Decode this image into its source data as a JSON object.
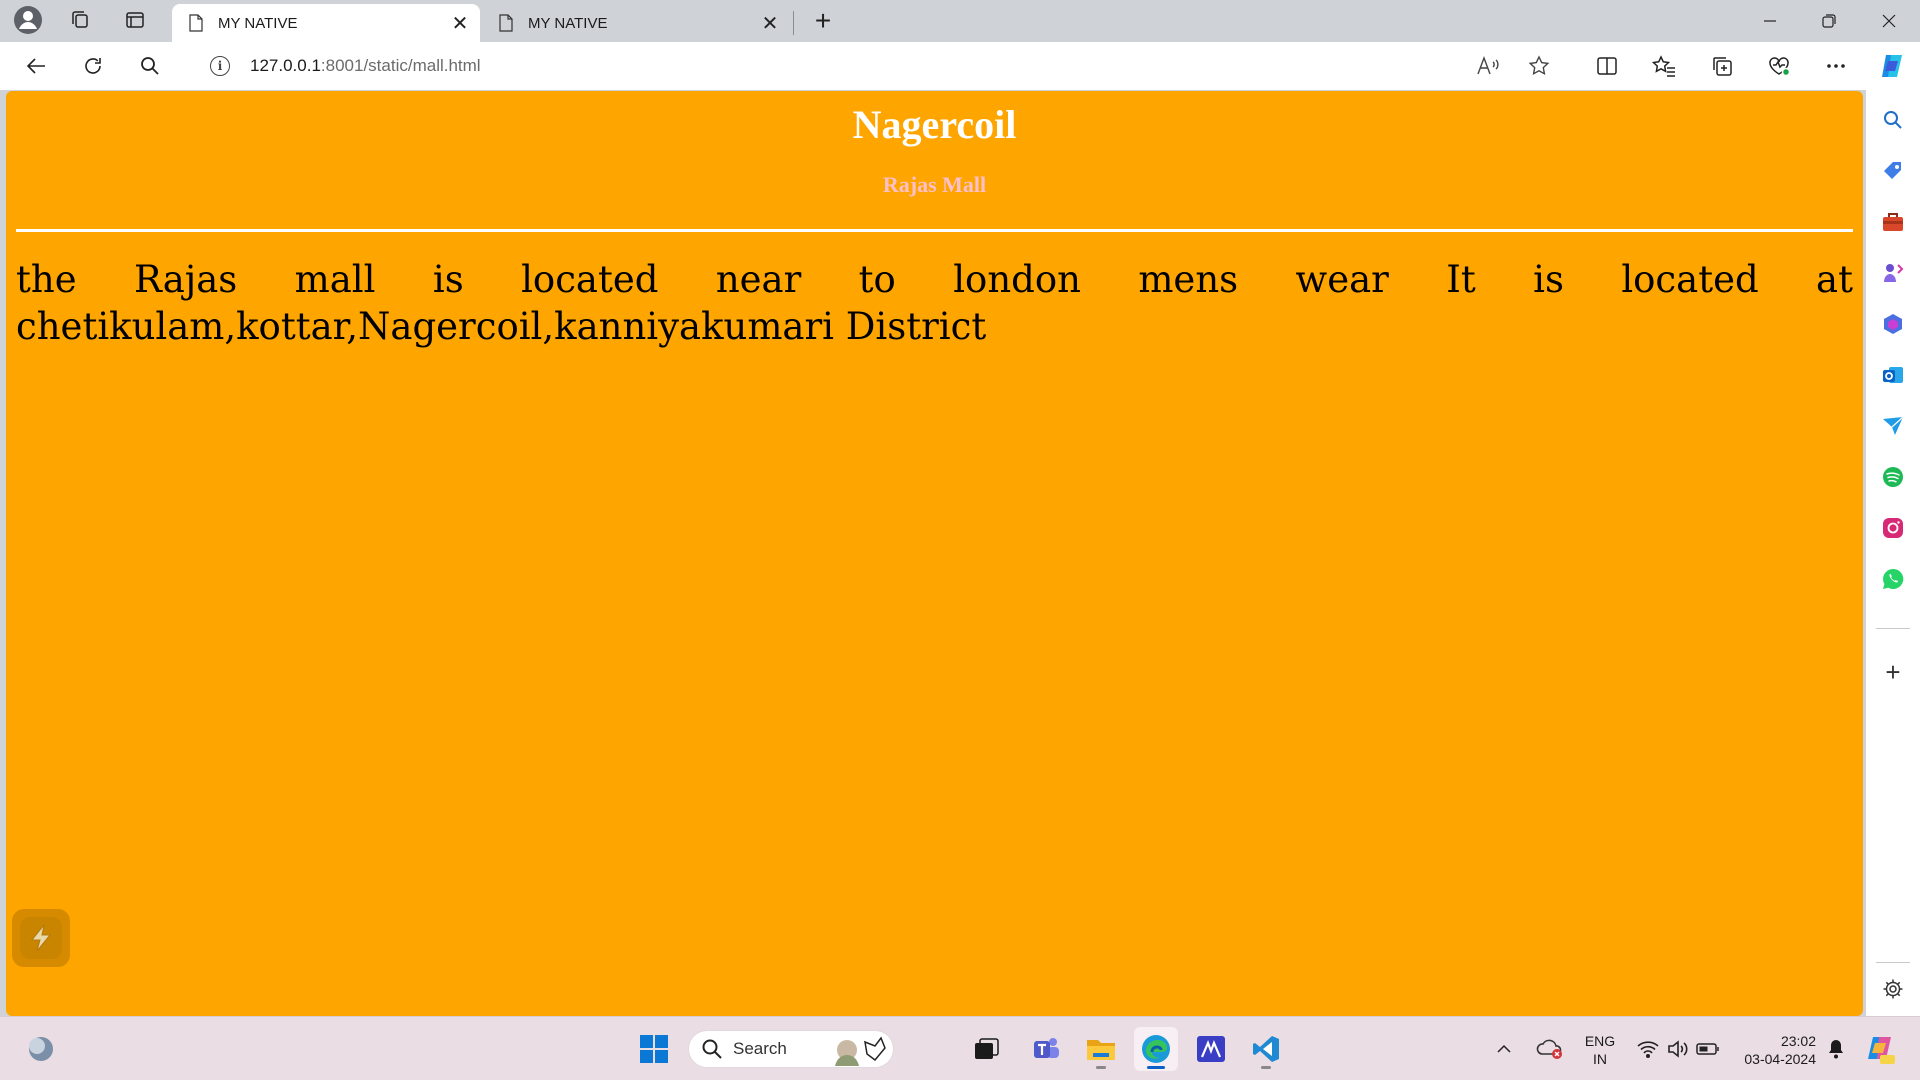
{
  "browser": {
    "tabs": [
      {
        "title": "MY NATIVE",
        "active": true
      },
      {
        "title": "MY NATIVE",
        "active": false
      }
    ],
    "address": {
      "host": "127.0.0.1",
      "rest": ":8001/static/mall.html"
    }
  },
  "page": {
    "heading": "Nagercoil",
    "subheading": "Rajas Mall",
    "paragraph": "the Rajas mall is located near to london mens wear It is located at chetikulam,kottar,Nagercoil,kanniyakumari District",
    "background_color": "#ffa500",
    "heading_color": "#ffffff",
    "subheading_color": "#ffc0cb"
  },
  "taskbar": {
    "search_label": "Search",
    "language": {
      "line1": "ENG",
      "line2": "IN"
    },
    "clock": {
      "time": "23:02",
      "date": "03-04-2024"
    }
  }
}
